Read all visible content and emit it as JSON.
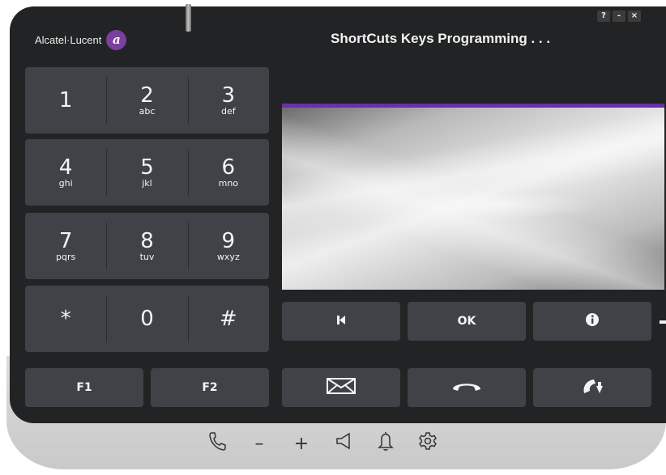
{
  "app": {
    "brand": "Alcatel·Lucent",
    "title": "ShortCuts Keys Programming . . .",
    "window_buttons": [
      "?",
      "-",
      "×"
    ]
  },
  "keypad": {
    "rows": [
      [
        {
          "digit": "1",
          "letters": ""
        },
        {
          "digit": "2",
          "letters": "abc"
        },
        {
          "digit": "3",
          "letters": "def"
        }
      ],
      [
        {
          "digit": "4",
          "letters": "ghi"
        },
        {
          "digit": "5",
          "letters": "jkl"
        },
        {
          "digit": "6",
          "letters": "mno"
        }
      ],
      [
        {
          "digit": "7",
          "letters": "pqrs"
        },
        {
          "digit": "8",
          "letters": "tuv"
        },
        {
          "digit": "9",
          "letters": "wxyz"
        }
      ],
      [
        {
          "digit": "*",
          "letters": ""
        },
        {
          "digit": "0",
          "letters": ""
        },
        {
          "digit": "#",
          "letters": ""
        }
      ]
    ],
    "f1": "F1",
    "f2": "F2"
  },
  "nav": {
    "back_icon": "skip-back-icon",
    "ok": "OK",
    "info_icon": "info-icon"
  },
  "call": {
    "message_icon": "envelope-icon",
    "hangup_icon": "hang-up-icon",
    "redial_icon": "redial-icon"
  },
  "bottom_bar": {
    "items": [
      "handset-icon",
      "volume-down-icon",
      "volume-up-icon",
      "speaker-icon",
      "bell-icon",
      "settings-icon"
    ],
    "minus": "–",
    "plus": "+"
  },
  "colors": {
    "panel": "#222324",
    "key": "#3f4347",
    "accent": "#6b2fa8",
    "base": "#d2d2d2"
  }
}
